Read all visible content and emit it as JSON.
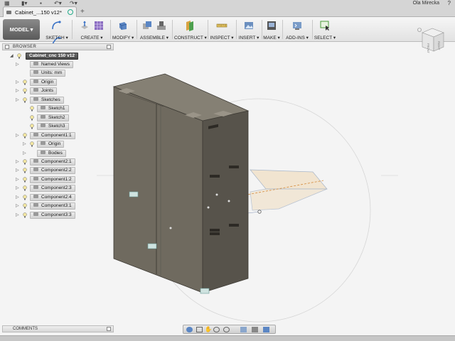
{
  "tabs": [
    {
      "label": "Cabinet_...150 v12*"
    }
  ],
  "user": {
    "name": "Ola Mirecka",
    "help": "?"
  },
  "toolbar": {
    "workspace": "MODEL ▾",
    "groups": [
      {
        "label": "SKETCH ▾"
      },
      {
        "label": "CREATE ▾"
      },
      {
        "label": "MODIFY ▾"
      },
      {
        "label": "ASSEMBLE ▾"
      },
      {
        "label": "CONSTRUCT ▾"
      },
      {
        "label": "INSPECT ▾"
      },
      {
        "label": "INSERT ▾"
      },
      {
        "label": "MAKE ▾"
      },
      {
        "label": "ADD-INS ▾"
      },
      {
        "label": "SELECT ▾"
      }
    ]
  },
  "viewcube": {
    "faces": [
      "FRONT",
      "RIGHT"
    ]
  },
  "browser": {
    "title": "BROWSER",
    "root": "Cabinet_cnc 150 v12",
    "items": [
      {
        "label": "Named Views"
      },
      {
        "label": "Units: mm"
      },
      {
        "label": "Origin"
      },
      {
        "label": "Joints"
      },
      {
        "label": "Sketches"
      },
      {
        "label": "Sketch1"
      },
      {
        "label": "Sketch2"
      },
      {
        "label": "Sketch3"
      },
      {
        "label": "Component1:1"
      },
      {
        "label": "Origin"
      },
      {
        "label": "Bodies"
      },
      {
        "label": "Component2:1"
      },
      {
        "label": "Component2:2"
      },
      {
        "label": "Component1:2"
      },
      {
        "label": "Component2:3"
      },
      {
        "label": "Component2:4"
      },
      {
        "label": "Component3:1"
      },
      {
        "label": "Component3:3"
      }
    ]
  },
  "comments": {
    "title": "COMMENTS"
  },
  "colors": {
    "cabinet_front": "#6f6a5f",
    "cabinet_side": "#57534b",
    "cabinet_top": "#858074",
    "sketch_plane": "#f1e4d0",
    "toolbar_accent": "#5b86c4"
  }
}
